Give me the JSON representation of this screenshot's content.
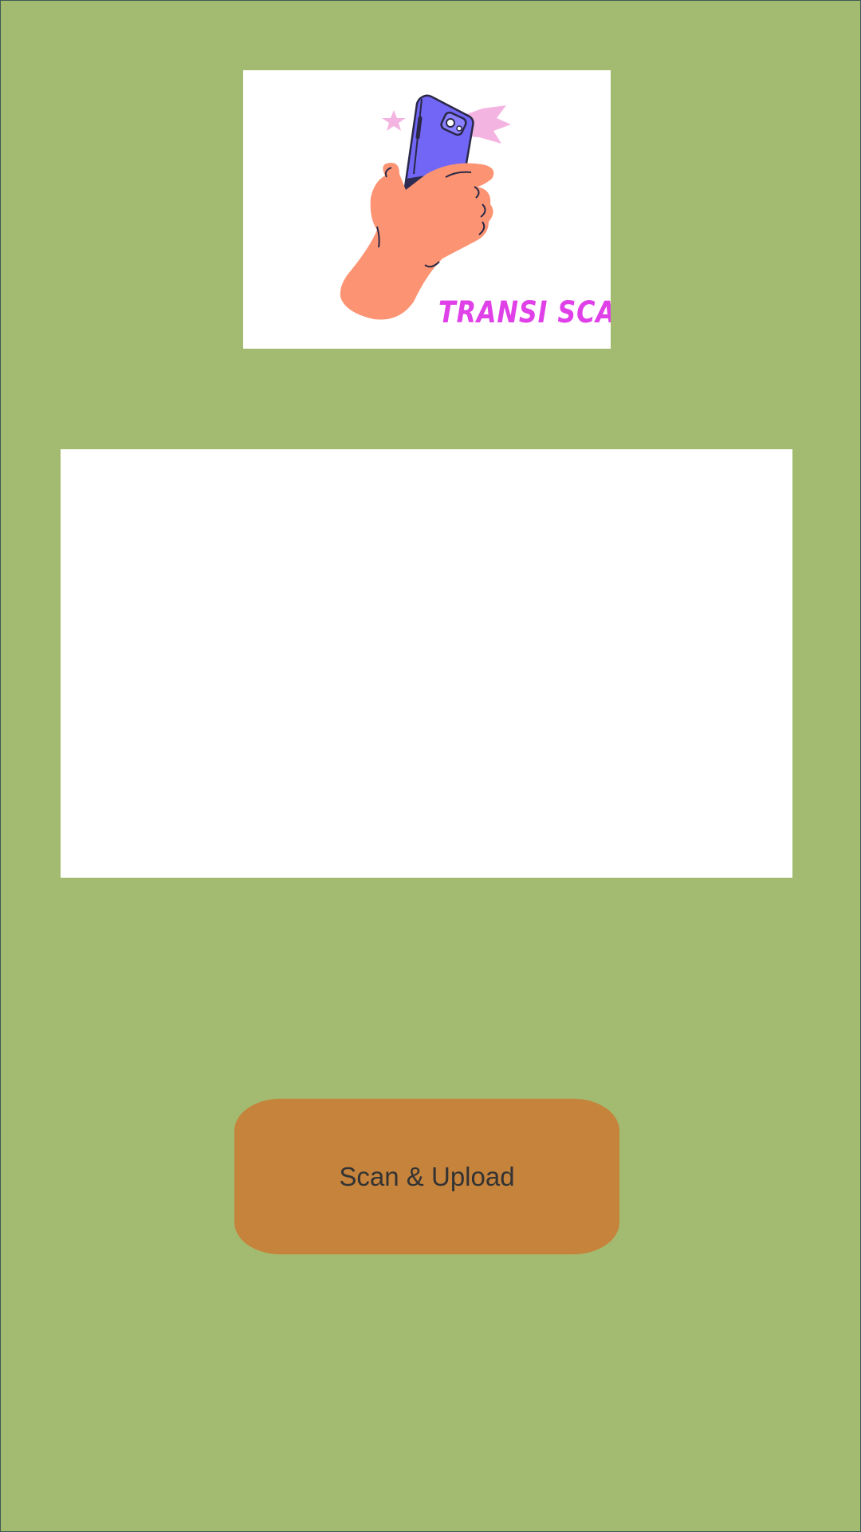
{
  "app": {
    "logo_text": "TRANSI SCAN",
    "logo_icon": "hand-holding-phone-icon"
  },
  "preview": {
    "state": "empty"
  },
  "actions": {
    "scan_upload_label": "Scan & Upload"
  },
  "colors": {
    "background": "#a3bb70",
    "card": "#ffffff",
    "button": "#c5833c",
    "button_text": "#333333",
    "logo_text": "#e040e8",
    "phone": "#7166f5",
    "hand": "#fc9473",
    "sparkle": "#f4b4e2"
  }
}
